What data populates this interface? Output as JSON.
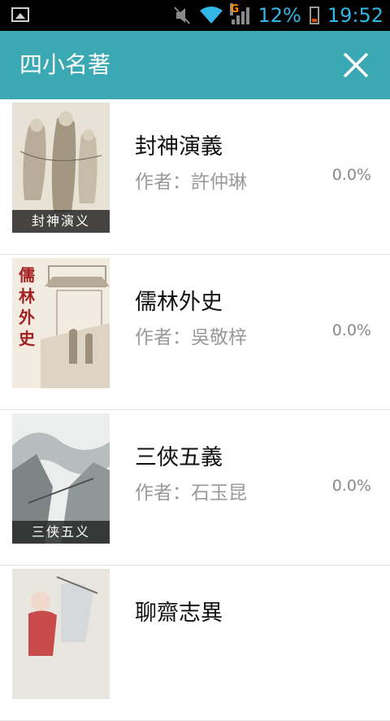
{
  "status_bar": {
    "battery": "12%",
    "time": "19:52",
    "network": "G"
  },
  "header": {
    "title": "四小名著"
  },
  "books": [
    {
      "title": "封神演義",
      "author": "作者：許仲琳",
      "progress": "0.0%",
      "cover_caption": "封神演义",
      "cover_vertical": ""
    },
    {
      "title": "儒林外史",
      "author": "作者：吳敬梓",
      "progress": "0.0%",
      "cover_caption": "",
      "cover_vertical": "儒林外史"
    },
    {
      "title": "三俠五義",
      "author": "作者：石玉昆",
      "progress": "0.0%",
      "cover_caption": "三侠五义",
      "cover_vertical": ""
    },
    {
      "title": "聊齋志異",
      "author": "",
      "progress": "",
      "cover_caption": "",
      "cover_vertical": ""
    }
  ]
}
